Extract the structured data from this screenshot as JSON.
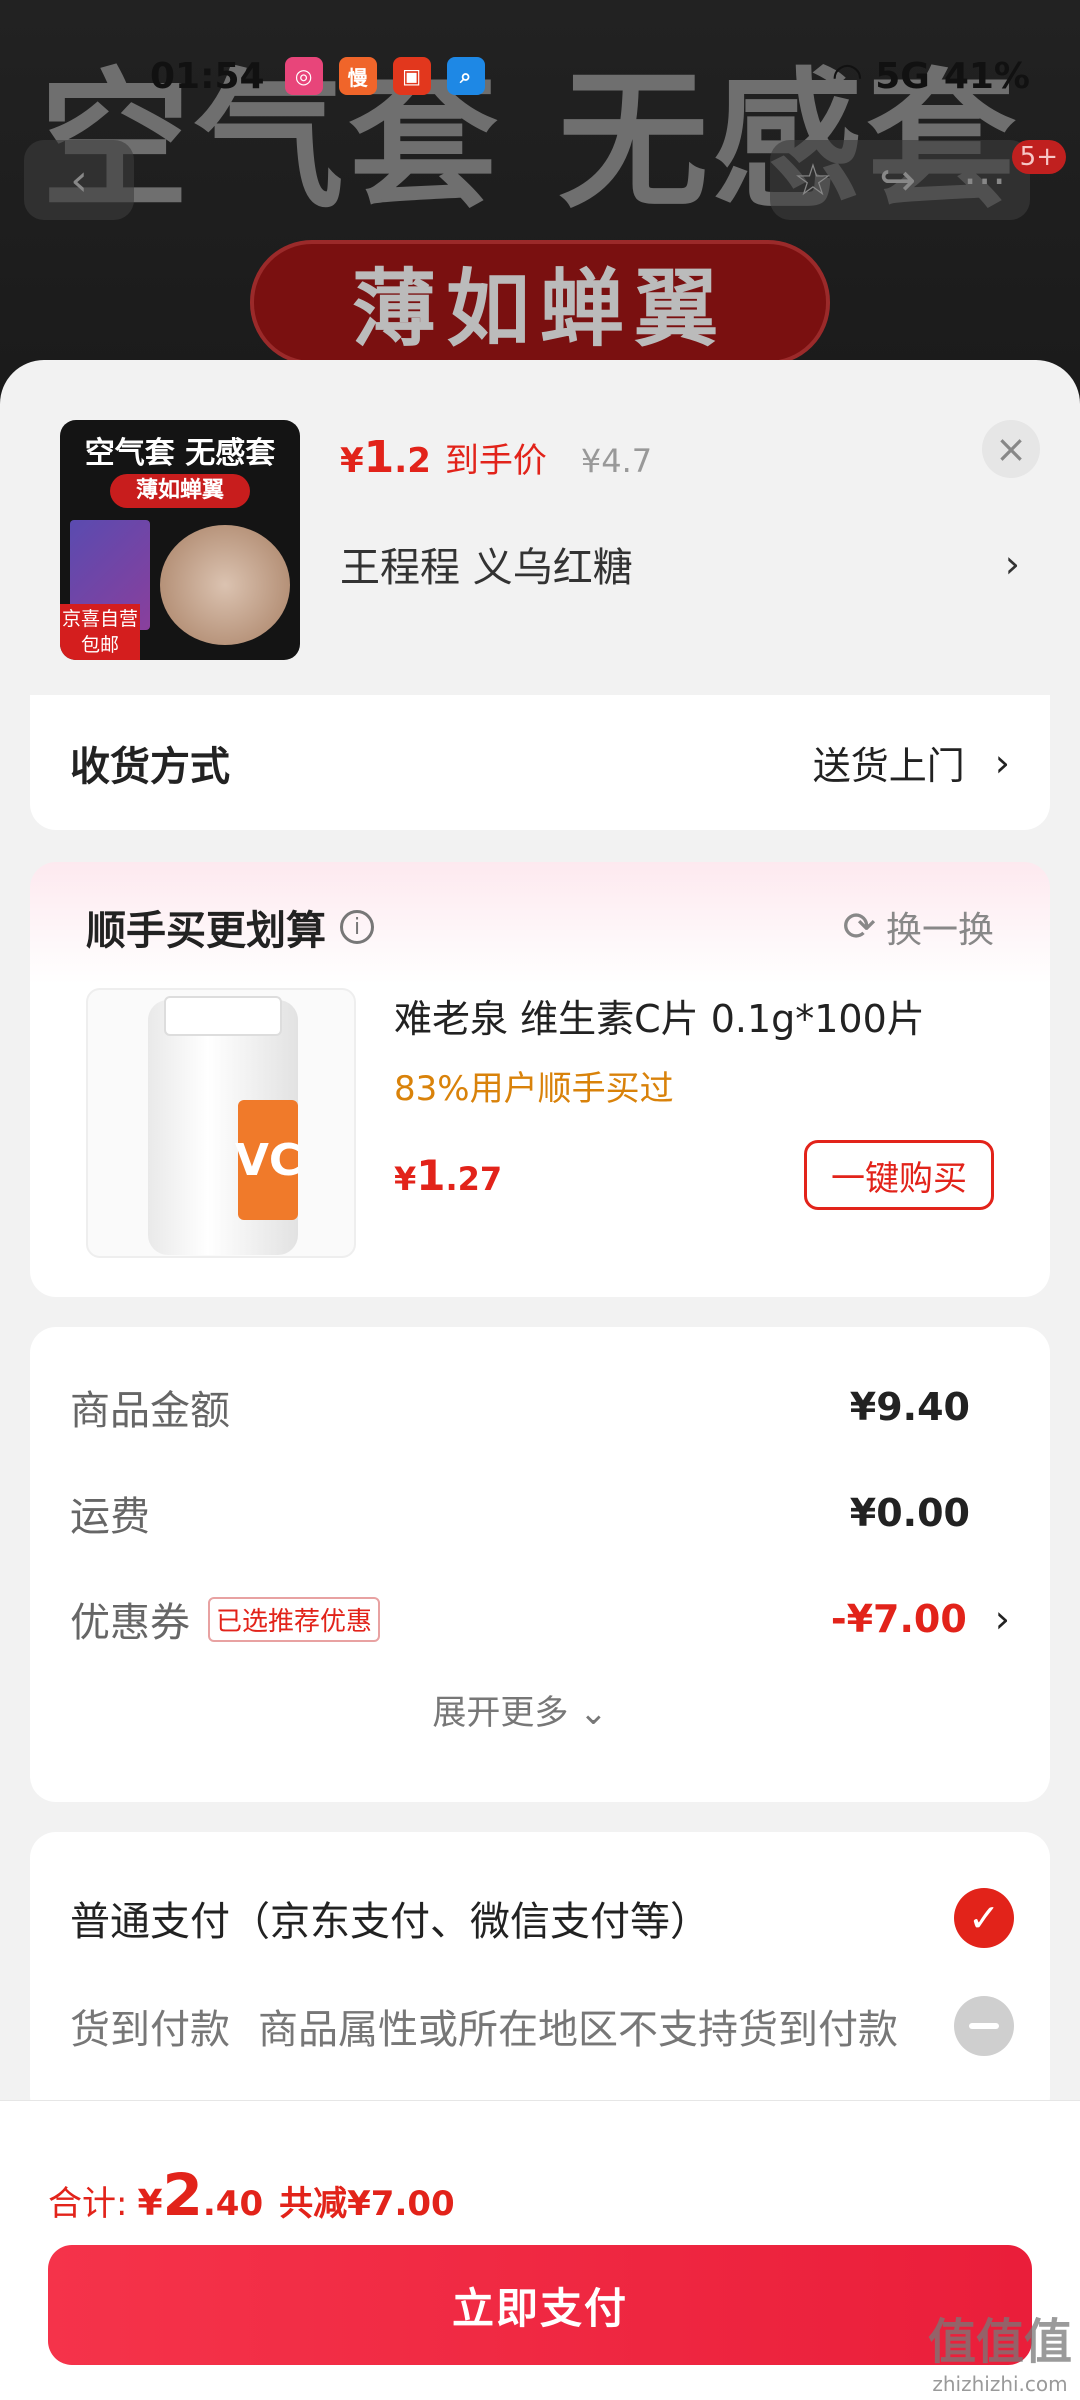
{
  "background": {
    "banner_text": "空气套 无感套",
    "pill_text": "薄如蝉翼",
    "badge": "5+"
  },
  "status_bar": {
    "time": "01:54",
    "battery": "41%",
    "network": "5G"
  },
  "product": {
    "thumb_title": "空气套 无感套",
    "thumb_pill": "薄如蝉翼",
    "thumb_tag": "京喜自营 包邮",
    "price_symbol": "¥",
    "price_int": "1",
    "price_dec": ".2",
    "price_label": "到手价",
    "original_price": "¥4.7",
    "shop_name": "王程程  义乌红糖"
  },
  "shipping": {
    "label": "收货方式",
    "value": "送货上门"
  },
  "upsell": {
    "title": "顺手买更划算",
    "swap_label": "换一换",
    "item_name": "难老泉 维生素C片 0.1g*100片",
    "item_sub": "83%用户顺手买过",
    "price_symbol": "¥",
    "price_int": "1",
    "price_dec": ".27",
    "buy_label": "一键购买",
    "bottle_label": "VC"
  },
  "amounts": {
    "goods_label": "商品金额",
    "goods_value": "¥9.40",
    "freight_label": "运费",
    "freight_value": "¥0.00",
    "coupon_label": "优惠券",
    "coupon_tag": "已选推荐优惠",
    "coupon_value": "-¥7.00",
    "expand_label": "展开更多"
  },
  "payment": {
    "normal_label": "普通支付（京东支付、微信支付等）",
    "cod_label": "货到付款",
    "cod_note": "商品属性或所在地区不支持货到付款"
  },
  "footer": {
    "total_label": "合计:",
    "total_cur": "¥",
    "total_int": "2",
    "total_dec": ".40",
    "total_saved": "共减¥7.00",
    "pay_button": "立即支付"
  },
  "watermark": {
    "line1": "值值值",
    "line2": "zhizhizhi.com"
  },
  "colors": {
    "accent": "#e2231a",
    "warning": "#d9820a",
    "pay_button": "#ea1e3a"
  }
}
